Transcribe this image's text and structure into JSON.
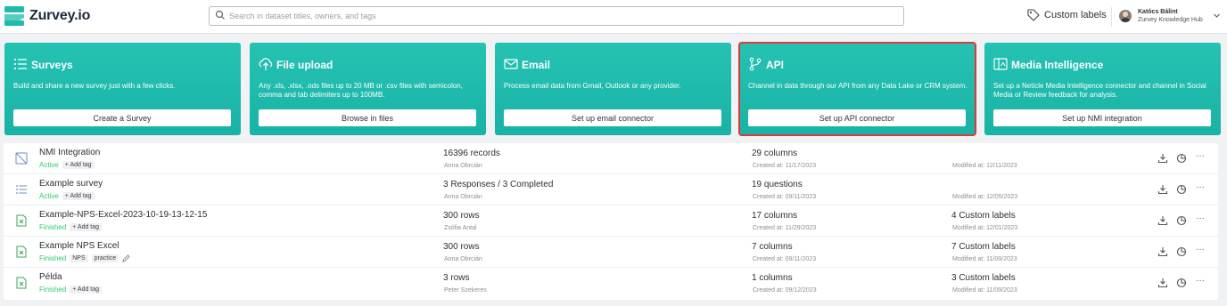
{
  "app": {
    "name": "Zurvey.io"
  },
  "search": {
    "placeholder": "Search in dataset titles, owners, and tags"
  },
  "header": {
    "custom_labels": "Custom labels"
  },
  "user": {
    "name": "Katócs Bálint",
    "org": "Zurvey Knowledge Hub"
  },
  "cards": [
    {
      "title": "Surveys",
      "desc": "Build and share a new survey just with a few clicks.",
      "button": "Create a Survey",
      "icon": "list-icon"
    },
    {
      "title": "File upload",
      "desc": "Any .xls, .xlsx, .ods files up to 20 MB or .csv files with semicolon, comma and tab delimiters up to 100MB.",
      "button": "Browse in files",
      "icon": "upload-icon"
    },
    {
      "title": "Email",
      "desc": "Process email data from Gmail, Outlook or any provider.",
      "button": "Set up email connector",
      "icon": "mail-icon"
    },
    {
      "title": "API",
      "desc": "Channel in data through our API from any Data Lake or CRM system.",
      "button": "Set up API connector",
      "icon": "branch-icon"
    },
    {
      "title": "Media Intelligence",
      "desc": "Set up a Neticle Media Intelligence connector and channel in Social Media or Review feedback for analysis.",
      "button": "Set up NMI integration",
      "icon": "media-icon"
    }
  ],
  "rows": [
    {
      "name": "NMI Integration",
      "status": "Active",
      "tags": [],
      "add_tag": "+ Add tag",
      "records": "16396 records",
      "owner": "Anna Obrcián",
      "columns": "29 columns",
      "created": "Created at: 11/17/2023",
      "labels": "",
      "modified": "Modified at: 12/11/2023",
      "icon": "nmi-icon"
    },
    {
      "name": "Example survey",
      "status": "Active",
      "tags": [],
      "add_tag": "+ Add tag",
      "records": "3 Responses / 3 Completed",
      "owner": "Anna Obrcián",
      "columns": "19 questions",
      "created": "Created at: 09/11/2023",
      "labels": "",
      "modified": "Modified at: 12/05/2023",
      "icon": "survey-icon"
    },
    {
      "name": "Example-NPS-Excel-2023-10-19-13-12-15",
      "status": "Finished",
      "tags": [],
      "add_tag": "+ Add tag",
      "records": "300 rows",
      "owner": "Zsófia Antal",
      "columns": "17 columns",
      "created": "Created at: 11/29/2023",
      "labels": "4 Custom labels",
      "modified": "Modified at: 12/01/2023",
      "icon": "excel-icon"
    },
    {
      "name": "Example NPS Excel",
      "status": "Finished",
      "tags": [
        "NPS",
        "practice"
      ],
      "add_tag": "",
      "records": "300 rows",
      "owner": "Anna Obrcián",
      "columns": "7 columns",
      "created": "Created at: 09/11/2023",
      "labels": "7 Custom labels",
      "modified": "Modified at: 11/09/2023",
      "icon": "excel-icon"
    },
    {
      "name": "Példa",
      "status": "Finished",
      "tags": [],
      "add_tag": "+ Add tag",
      "records": "3 rows",
      "owner": "Peter Szekeres",
      "columns": "1 columns",
      "created": "Created at: 09/12/2023",
      "labels": "3 Custom labels",
      "modified": "Modified at: 11/09/2023",
      "icon": "excel-icon"
    }
  ],
  "row_actions": {
    "more": "···"
  },
  "colors": {
    "accent": "#1fbcad",
    "active": "#2ecc71",
    "highlight": "#d93a3a"
  }
}
